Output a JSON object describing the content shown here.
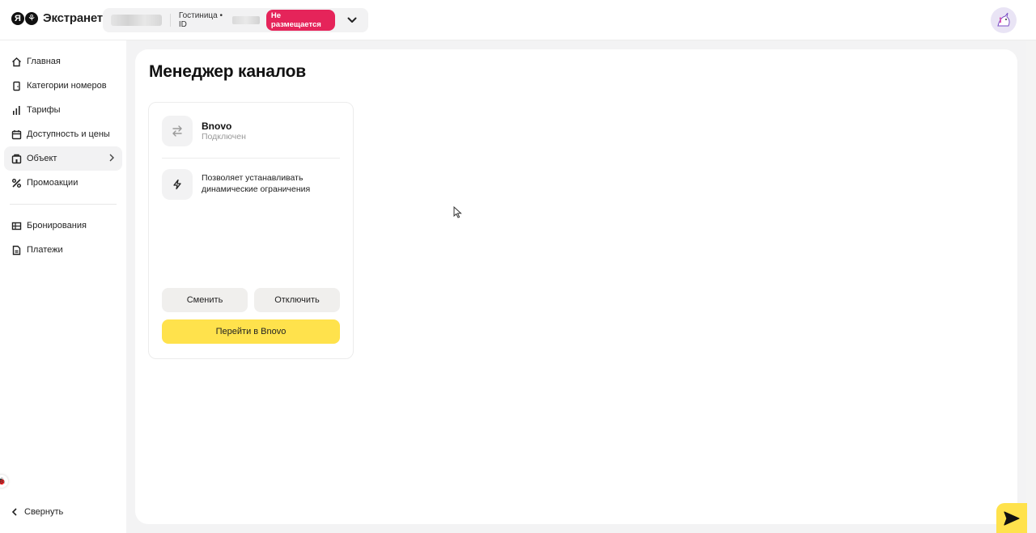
{
  "header": {
    "logo_text": "Экстранет",
    "hotel_type": "Гостиница • ID",
    "status_badge": "Не размещается"
  },
  "sidebar": {
    "items": [
      {
        "label": "Главная",
        "icon": "home-icon"
      },
      {
        "label": "Категории номеров",
        "icon": "door-icon"
      },
      {
        "label": "Тарифы",
        "icon": "bars-icon"
      },
      {
        "label": "Доступность и цены",
        "icon": "calendar-icon"
      },
      {
        "label": "Объект",
        "icon": "building-icon"
      },
      {
        "label": "Промоакции",
        "icon": "percent-icon"
      },
      {
        "label": "Бронирования",
        "icon": "table-icon"
      },
      {
        "label": "Платежи",
        "icon": "document-icon"
      }
    ],
    "collapse_label": "Свернуть"
  },
  "main": {
    "title": "Менеджер каналов",
    "card": {
      "name": "Bnovo",
      "status": "Подключен",
      "feature": "Позволяет устанавливать динамические ограничения",
      "change_label": "Сменить",
      "disable_label": "Отключить",
      "go_label": "Перейти в Bnovo"
    }
  },
  "colors": {
    "accent_yellow": "#ffe24c",
    "badge_red": "#e5245a"
  }
}
